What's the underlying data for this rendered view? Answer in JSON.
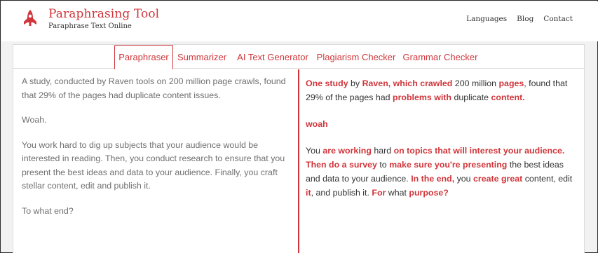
{
  "header": {
    "brand_title": "Paraphrasing Tool",
    "brand_subtitle": "Paraphrase Text Online",
    "nav": [
      "Languages",
      "Blog",
      "Contact"
    ]
  },
  "tabs": [
    "Paraphraser",
    "Summarizer",
    "AI Text Generator",
    "Plagiarism Checker",
    "Grammar Checker"
  ],
  "active_tab": "Paraphraser",
  "input_text": {
    "p1": "A study, conducted by Raven tools on 200 million page crawls, found that 29% of the pages had duplicate content issues.",
    "p2": "Woah.",
    "p3": "You work hard to dig up subjects that your audience would be interested in reading. Then, you conduct research to ensure that you present the best ideas and data to your audience. Finally, you craft stellar content, edit and publish it.",
    "p4": "To what end?"
  },
  "output_text": {
    "p1": [
      {
        "t": "One study",
        "hl": true
      },
      {
        "t": " by ",
        "hl": false
      },
      {
        "t": "Raven, which crawled",
        "hl": true
      },
      {
        "t": " 200 million ",
        "hl": false
      },
      {
        "t": "pages",
        "hl": true
      },
      {
        "t": ", found that 29% of the pages had ",
        "hl": false
      },
      {
        "t": "problems with",
        "hl": true
      },
      {
        "t": " duplicate ",
        "hl": false
      },
      {
        "t": "content.",
        "hl": true
      }
    ],
    "p2": [
      {
        "t": "woah",
        "hl": true
      }
    ],
    "p3": [
      {
        "t": "You ",
        "hl": false
      },
      {
        "t": "are working",
        "hl": true
      },
      {
        "t": " hard ",
        "hl": false
      },
      {
        "t": "on topics that will interest your audience. Then do a survey",
        "hl": true
      },
      {
        "t": " to ",
        "hl": false
      },
      {
        "t": "make sure you're presenting",
        "hl": true
      },
      {
        "t": " the best ideas and data to your audience. ",
        "hl": false
      },
      {
        "t": "In the end,",
        "hl": true
      },
      {
        "t": " you ",
        "hl": false
      },
      {
        "t": "create great",
        "hl": true
      },
      {
        "t": " content, edit ",
        "hl": false
      },
      {
        "t": "it",
        "hl": true
      },
      {
        "t": ", and publish it. ",
        "hl": false
      },
      {
        "t": "For",
        "hl": true
      },
      {
        "t": " what ",
        "hl": false
      },
      {
        "t": "purpose?",
        "hl": true
      }
    ]
  },
  "colors": {
    "accent": "#d0363b",
    "muted_text": "#6f6f6f"
  }
}
